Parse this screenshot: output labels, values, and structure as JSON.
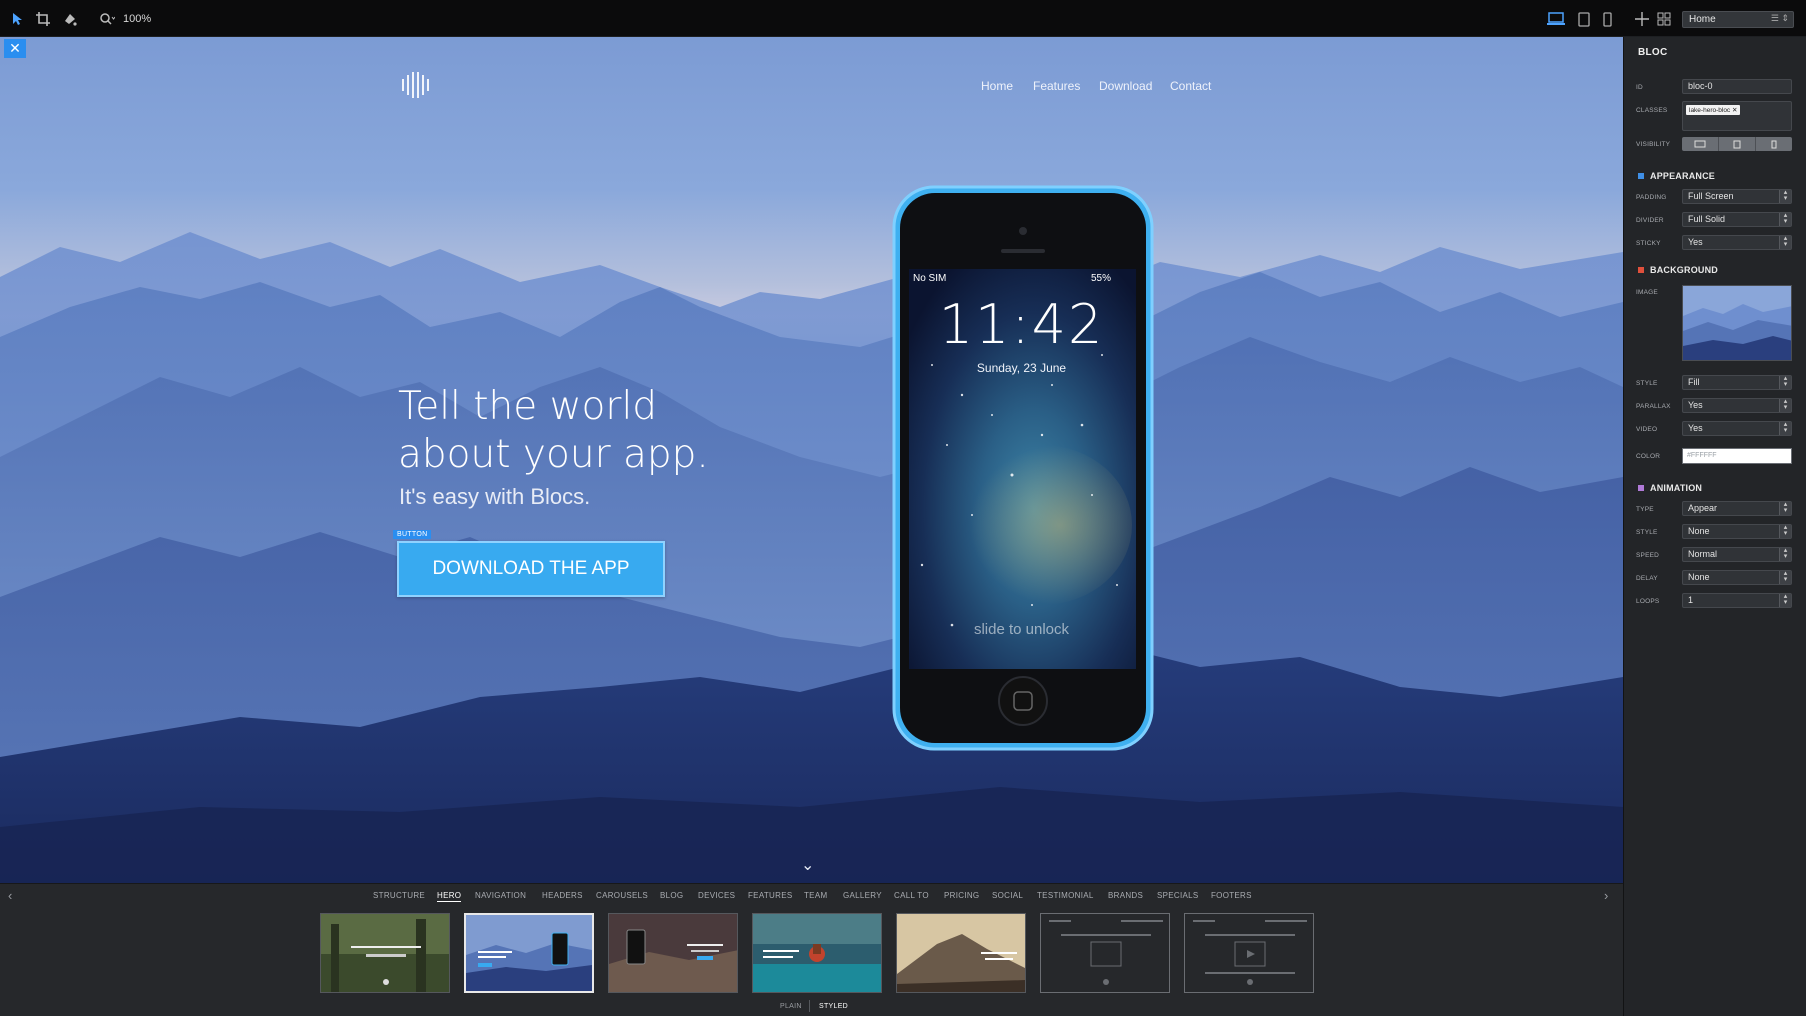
{
  "toolbar": {
    "zoom": "100%",
    "page": "Home"
  },
  "canvas": {
    "nav": [
      "Home",
      "Features",
      "Download",
      "Contact"
    ],
    "hero_line1": "Tell the world",
    "hero_line2": "about your app.",
    "hero_sub": "It's easy with Blocs.",
    "button_tag": "BUTTON",
    "button_label": "DOWNLOAD THE APP",
    "phone": {
      "carrier": "No SIM",
      "battery": "55%",
      "time": "11:42",
      "date": "Sunday, 23 June",
      "unlock": "slide to unlock"
    }
  },
  "inspector": {
    "title": "BLOC",
    "id_label": "ID",
    "id_value": "bloc-0",
    "classes_label": "CLASSES",
    "class_tag": "lake-hero-bloc",
    "visibility_label": "VISIBILITY",
    "appearance": {
      "title": "APPEARANCE",
      "color": "#3f8fe6",
      "padding_label": "PADDING",
      "padding": "Full Screen",
      "divider_label": "DIVIDER",
      "divider": "Full Solid",
      "sticky_label": "STICKY",
      "sticky": "Yes"
    },
    "background": {
      "title": "BACKGROUND",
      "color": "#e0503c",
      "image_label": "IMAGE",
      "style_label": "STYLE",
      "style": "Fill",
      "parallax_label": "PARALLAX",
      "parallax": "Yes",
      "video_label": "VIDEO",
      "video": "Yes",
      "color_label": "COLOR",
      "color_value": "#FFFFFF"
    },
    "animation": {
      "title": "ANIMATION",
      "color": "#b07ad8",
      "type_label": "TYPE",
      "type": "Appear",
      "style_label": "STYLE",
      "style": "None",
      "speed_label": "SPEED",
      "speed": "Normal",
      "delay_label": "DELAY",
      "delay": "None",
      "loops_label": "LOOPS",
      "loops": "1"
    }
  },
  "library": {
    "categories": [
      "STRUCTURE",
      "HERO",
      "NAVIGATION",
      "HEADERS",
      "CAROUSELS",
      "BLOG",
      "DEVICES",
      "FEATURES",
      "TEAM",
      "GALLERY",
      "CALL TO",
      "PRICING",
      "SOCIAL",
      "TESTIMONIAL",
      "BRANDS",
      "SPECIALS",
      "FOOTERS"
    ],
    "active_category": "HERO",
    "view_plain": "PLAIN",
    "view_styled": "STYLED"
  },
  "icons": [
    "pointer-icon",
    "crop-icon",
    "paint-icon",
    "zoom-icon",
    "desktop-icon",
    "tablet-icon",
    "mobile-icon",
    "add-icon",
    "grid-icon",
    "close-icon",
    "chevron-down-icon",
    "chevron-left-icon",
    "chevron-right-icon"
  ]
}
